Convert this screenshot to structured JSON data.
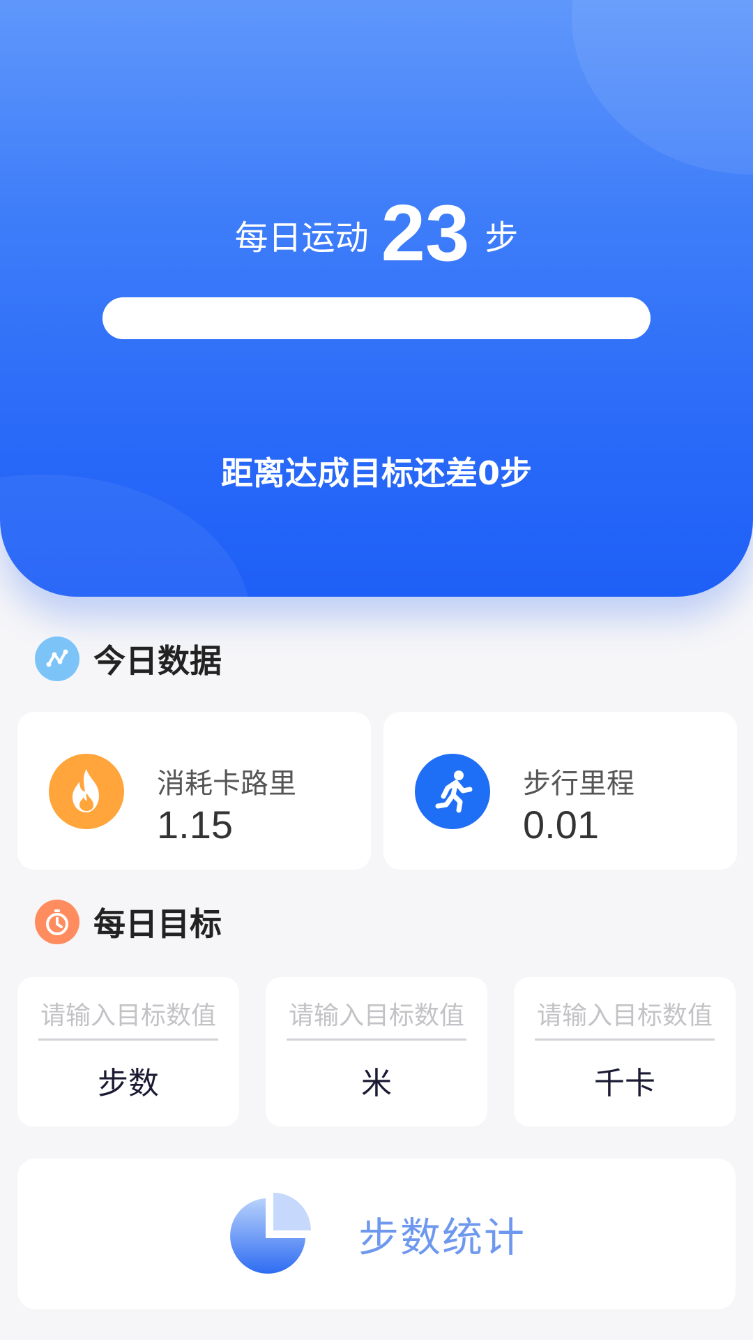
{
  "hero": {
    "prefix": "每日运动",
    "steps": "23",
    "suffix": "步",
    "progress_percent": 100,
    "remaining_text": "距离达成目标还差0步"
  },
  "today": {
    "title": "今日数据",
    "calories": {
      "label": "消耗卡路里",
      "value": "1.15",
      "icon": "flame-icon"
    },
    "distance": {
      "label": "步行里程",
      "value": "0.01",
      "icon": "running-man-icon"
    }
  },
  "goals": {
    "title": "每日目标",
    "items": [
      {
        "placeholder": "请输入目标数值",
        "value": "",
        "unit": "步数"
      },
      {
        "placeholder": "请输入目标数值",
        "value": "",
        "unit": "米"
      },
      {
        "placeholder": "请输入目标数值",
        "value": "",
        "unit": "千卡"
      }
    ]
  },
  "stats_button": {
    "label": "步数统计",
    "icon": "pie-chart-icon"
  },
  "colors": {
    "hero_blue": "#2b6bf8",
    "flame_orange": "#ffa53b",
    "runner_blue": "#1f6ef6",
    "stats_label": "#6e98ee",
    "goal_icon_orange": "#ff8c5f",
    "data_icon_blue": "#7cc3f8"
  }
}
